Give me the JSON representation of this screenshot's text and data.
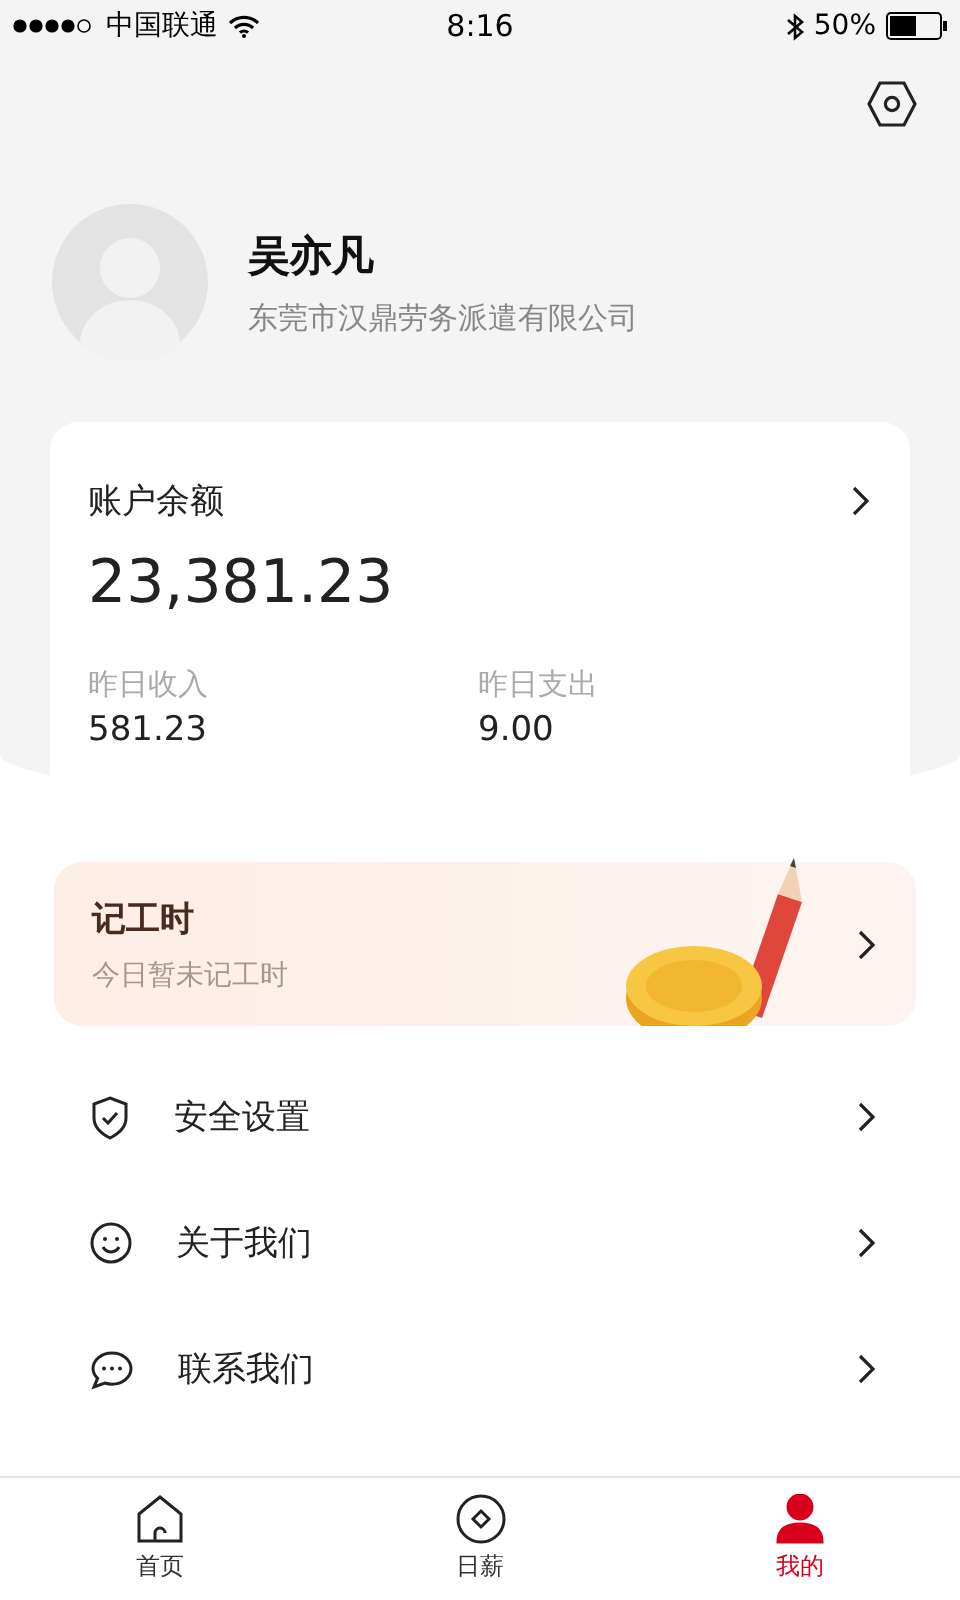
{
  "status_bar": {
    "carrier": "中国联通",
    "time": "8:16",
    "battery": "50%"
  },
  "profile": {
    "name": "吴亦凡",
    "company": "东莞市汉鼎劳务派遣有限公司"
  },
  "balance_card": {
    "title": "账户余额",
    "amount": "23,381.23",
    "stats": [
      {
        "label": "昨日收入",
        "value": "581.23"
      },
      {
        "label": "昨日支出",
        "value": "9.00"
      }
    ]
  },
  "work_hours": {
    "title": "记工时",
    "subtitle": "今日暂未记工时"
  },
  "menu": [
    {
      "kind": "shield",
      "label": "安全设置"
    },
    {
      "kind": "smile",
      "label": "关于我们"
    },
    {
      "kind": "chat",
      "label": "联系我们"
    }
  ],
  "tabs": [
    {
      "kind": "home",
      "label": "首页",
      "selected": false
    },
    {
      "kind": "coin",
      "label": "日薪",
      "selected": false
    },
    {
      "kind": "person",
      "label": "我的",
      "selected": true
    }
  ]
}
